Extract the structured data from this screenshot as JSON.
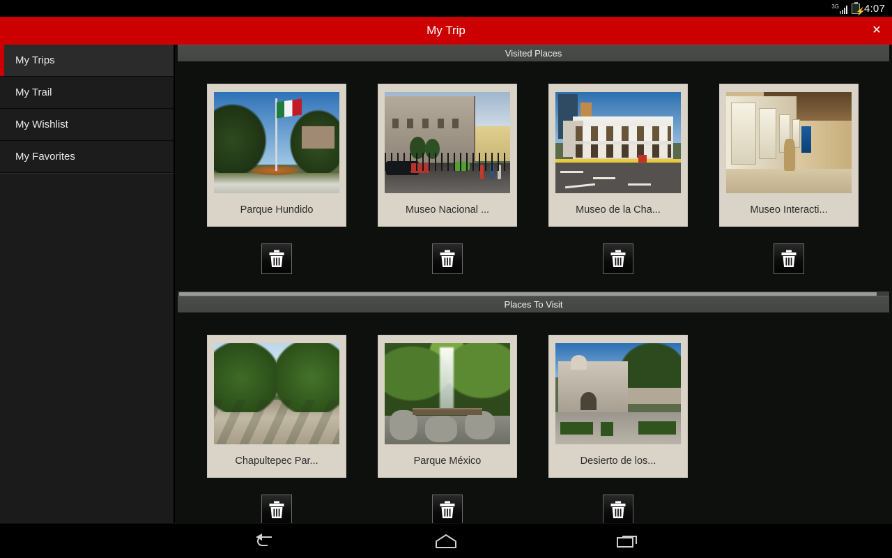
{
  "status_bar": {
    "network_label": "3G",
    "network_icon": "signal-bars-icon",
    "battery_icon": "battery-charging-icon",
    "time": "4:07"
  },
  "title_bar": {
    "title": "My Trip",
    "close_label": "✕",
    "background_color": "#cc0000",
    "text_color": "#ffffff"
  },
  "sidebar": {
    "items": [
      {
        "label": "My Trips",
        "selected": true
      },
      {
        "label": "My Trail",
        "selected": false
      },
      {
        "label": "My Wishlist",
        "selected": false
      },
      {
        "label": "My Favorites",
        "selected": false
      }
    ],
    "selected_indicator_color": "#cc0000"
  },
  "sections": [
    {
      "header": "Visited Places",
      "has_scrollbar": false,
      "cards": [
        {
          "caption": "Parque Hundido",
          "delete_label": "delete",
          "photo": "parque-hundido-photo"
        },
        {
          "caption": "Museo Nacional ...",
          "delete_label": "delete",
          "photo": "museo-nacional-photo"
        },
        {
          "caption": "Museo de la Cha...",
          "delete_label": "delete",
          "photo": "museo-de-la-charreria-photo"
        },
        {
          "caption": "Museo Interacti...",
          "delete_label": "delete",
          "photo": "museo-interactivo-photo"
        }
      ]
    },
    {
      "header": "Places To Visit",
      "has_scrollbar": true,
      "cards": [
        {
          "caption": "Chapultepec Par...",
          "delete_label": "delete",
          "photo": "chapultepec-park-photo"
        },
        {
          "caption": "Parque México",
          "delete_label": "delete",
          "photo": "parque-mexico-photo"
        },
        {
          "caption": "Desierto de los...",
          "delete_label": "delete",
          "photo": "desierto-de-los-leones-photo"
        }
      ]
    }
  ],
  "nav_bar": {
    "back_label": "Back",
    "home_label": "Home",
    "recents_label": "Recent apps"
  },
  "colors": {
    "accent": "#cc0000",
    "card_background": "#d9d4c7",
    "section_header": "#474a47",
    "app_background": "#0e100e",
    "sidebar_background": "#1c1c1c"
  }
}
